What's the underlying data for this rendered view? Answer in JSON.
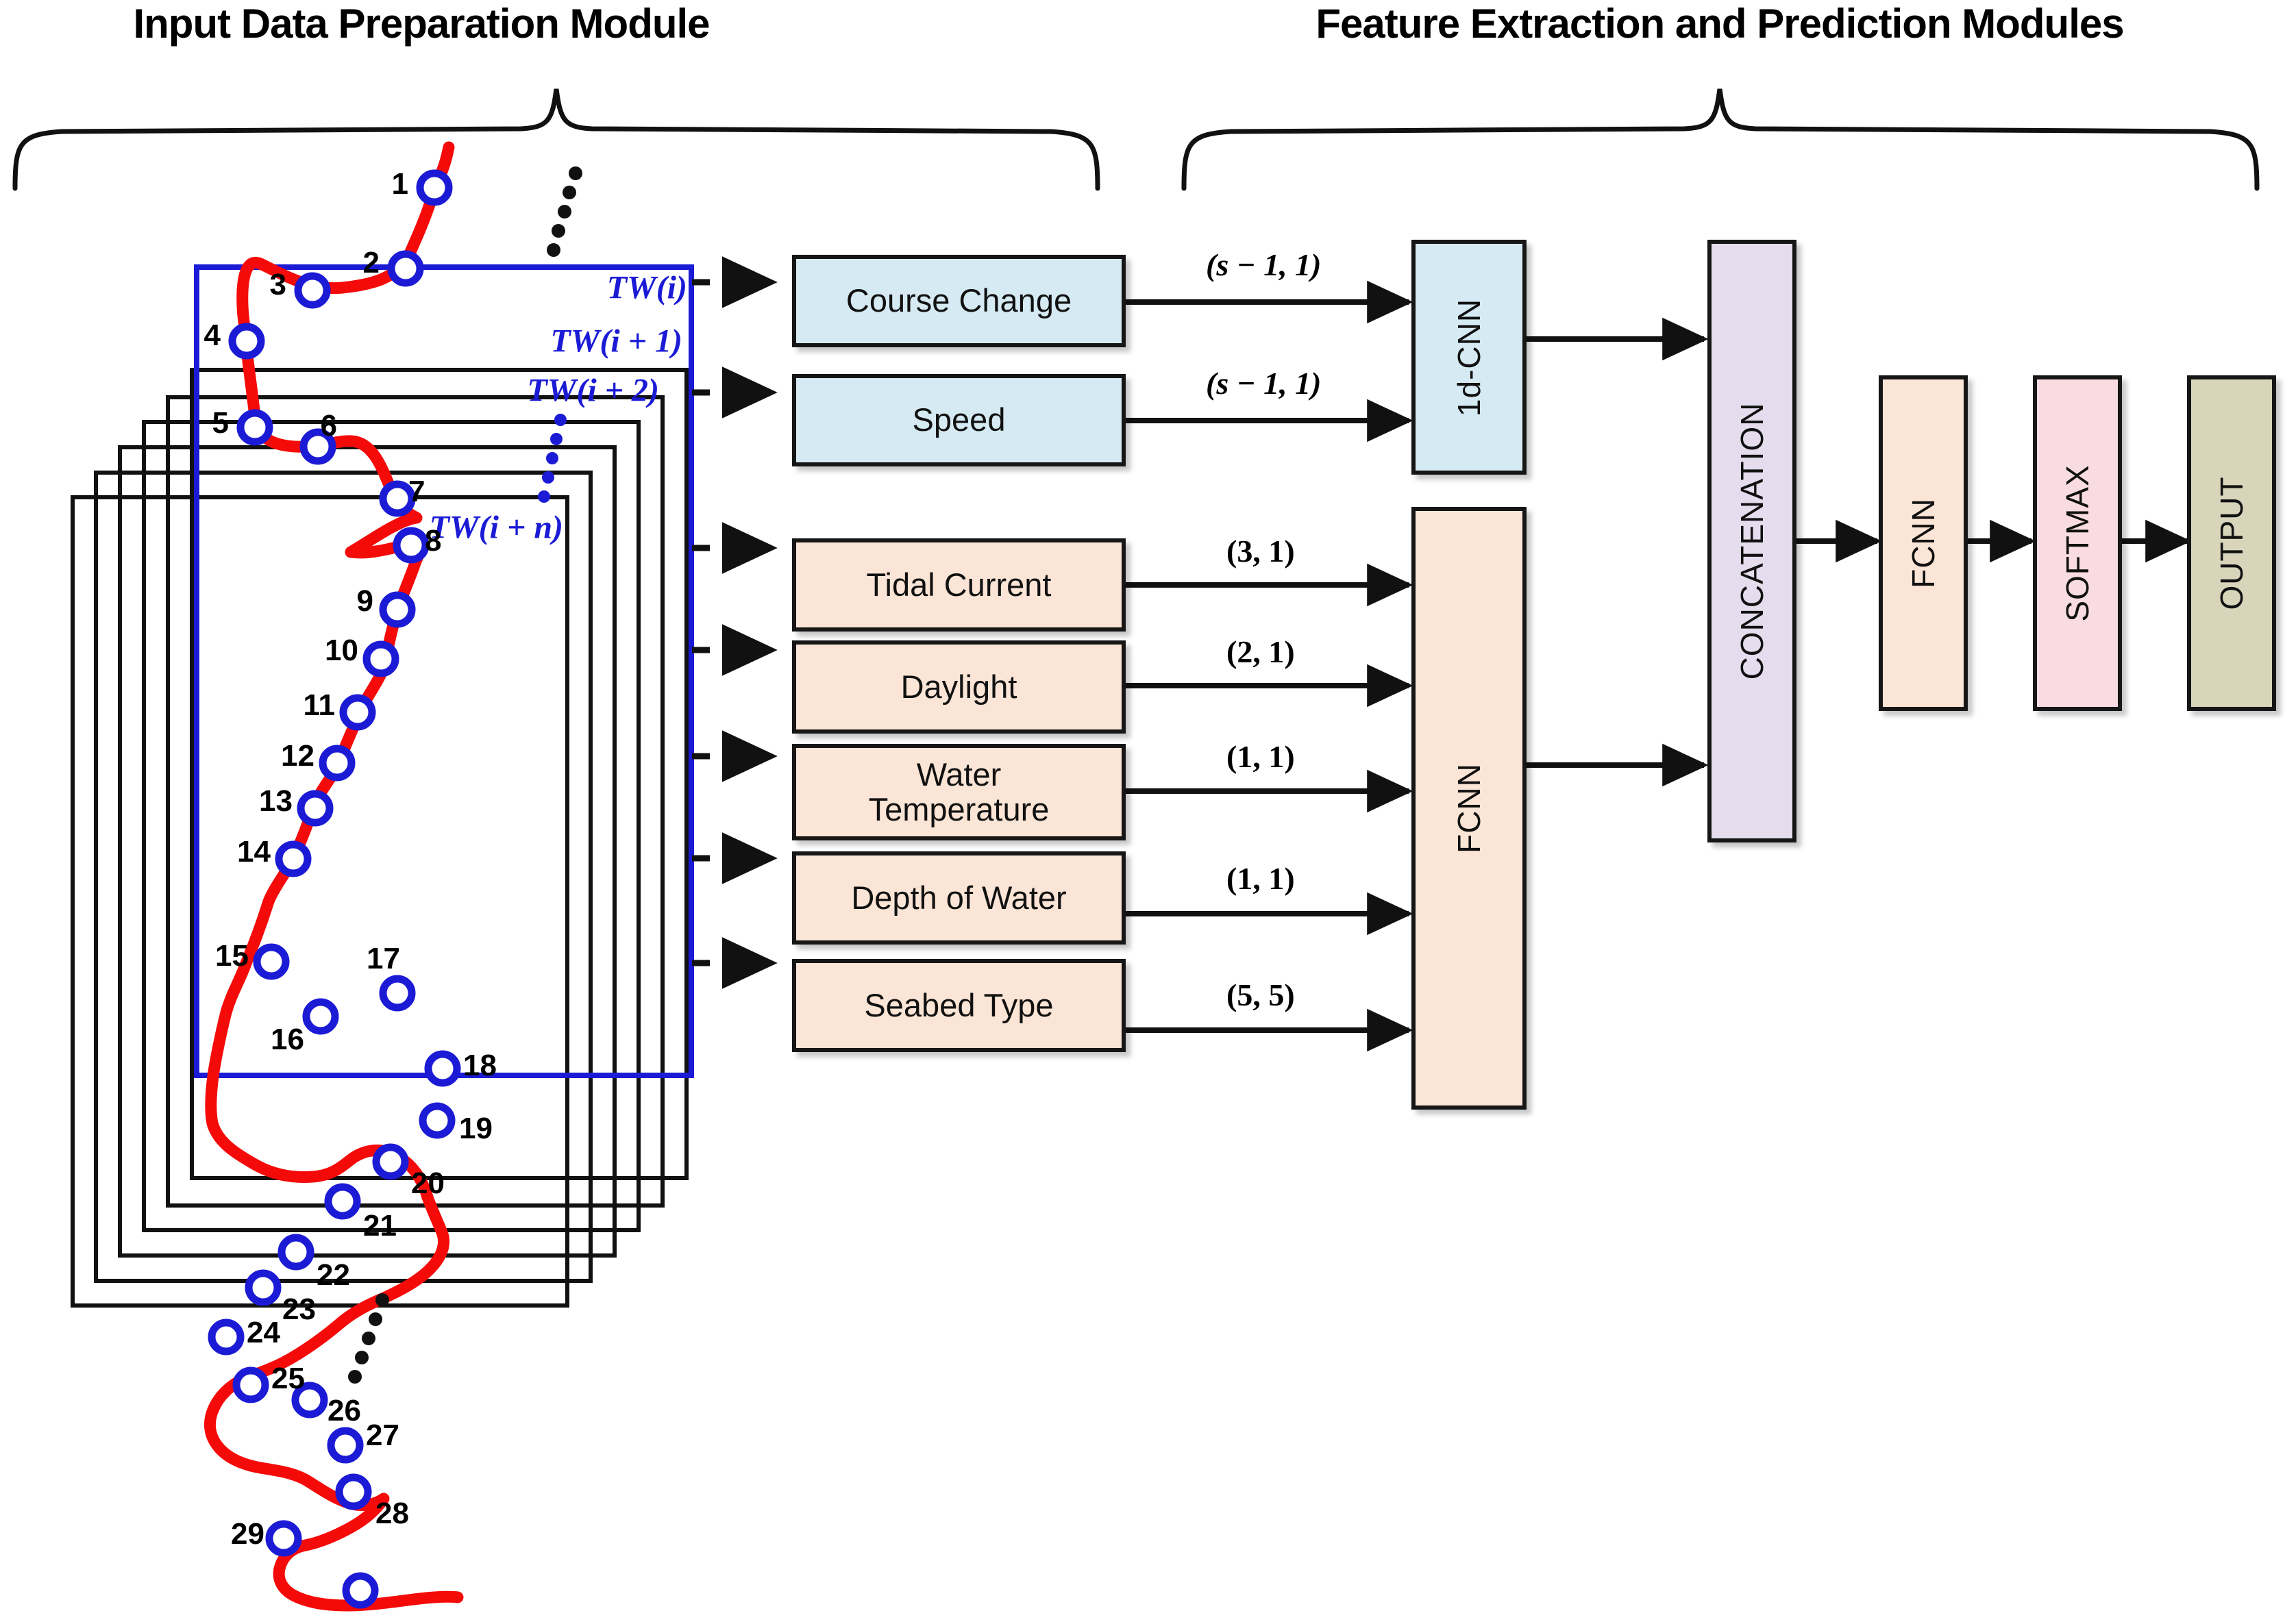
{
  "titles": {
    "left": "Input Data Preparation Module",
    "right": "Feature Extraction and Prediction Modules"
  },
  "time_windows": [
    {
      "label": "TW(i)",
      "color": "#1b1bd6",
      "stroke": "#1b1bd6"
    },
    {
      "label": "TW(i + 1)",
      "color": "#1b1bd6",
      "stroke": "#000000"
    },
    {
      "label": "TW(i + 2)",
      "color": "#1b1bd6",
      "stroke": "#000000"
    },
    {
      "label": "TW(i + n)",
      "color": "#1b1bd6",
      "stroke": "#000000"
    }
  ],
  "trajectory": {
    "point_labels": [
      "1",
      "2",
      "3",
      "4",
      "5",
      "6",
      "7",
      "8",
      "9",
      "10",
      "11",
      "12",
      "13",
      "14",
      "15",
      "16",
      "17",
      "18",
      "19",
      "20",
      "21",
      "22",
      "23",
      "24",
      "25",
      "26",
      "27",
      "28",
      "29"
    ],
    "marker_color": "#1b1bd6",
    "path_color": "#f50a0a"
  },
  "feature_inputs": [
    {
      "label": "Course Change",
      "shape": "(s − 1, 1)",
      "fill": "#d5eaf3",
      "target": "1d-CNN"
    },
    {
      "label": "Speed",
      "shape": "(s − 1, 1)",
      "fill": "#d5eaf3",
      "target": "1d-CNN"
    },
    {
      "label": "Tidal Current",
      "shape": "(3, 1)",
      "fill": "#fbe5d6",
      "target": "FCNN"
    },
    {
      "label": "Daylight",
      "shape": "(2, 1)",
      "fill": "#fbe5d6",
      "target": "FCNN"
    },
    {
      "label": "Water\nTemperature",
      "label_line1": "Water",
      "label_line2": "Temperature",
      "shape": "(1, 1)",
      "fill": "#fbe5d6",
      "target": "FCNN"
    },
    {
      "label": "Depth of Water",
      "shape": "(1, 1)",
      "fill": "#fbe5d6",
      "target": "FCNN"
    },
    {
      "label": "Seabed Type",
      "shape": "(5, 5)",
      "fill": "#fbe5d6",
      "target": "FCNN"
    }
  ],
  "pipeline": [
    {
      "label": "1d-CNN",
      "fill": "#d5eaf3"
    },
    {
      "label": "FCNN",
      "fill": "#fbe5d6"
    },
    {
      "label": "CONCATENATION",
      "fill": "#e5dded"
    },
    {
      "label": "FCNN",
      "fill": "#fbe5d6"
    },
    {
      "label": "SOFTMAX",
      "fill": "#f9dce1"
    },
    {
      "label": "OUTPUT",
      "fill": "#d8d5bb"
    }
  ],
  "colors": {
    "outline": "#161616",
    "trajectory_line": "#f50a0a",
    "marker": "#1b1bd6",
    "tw_primary": "#1b1bd6"
  }
}
